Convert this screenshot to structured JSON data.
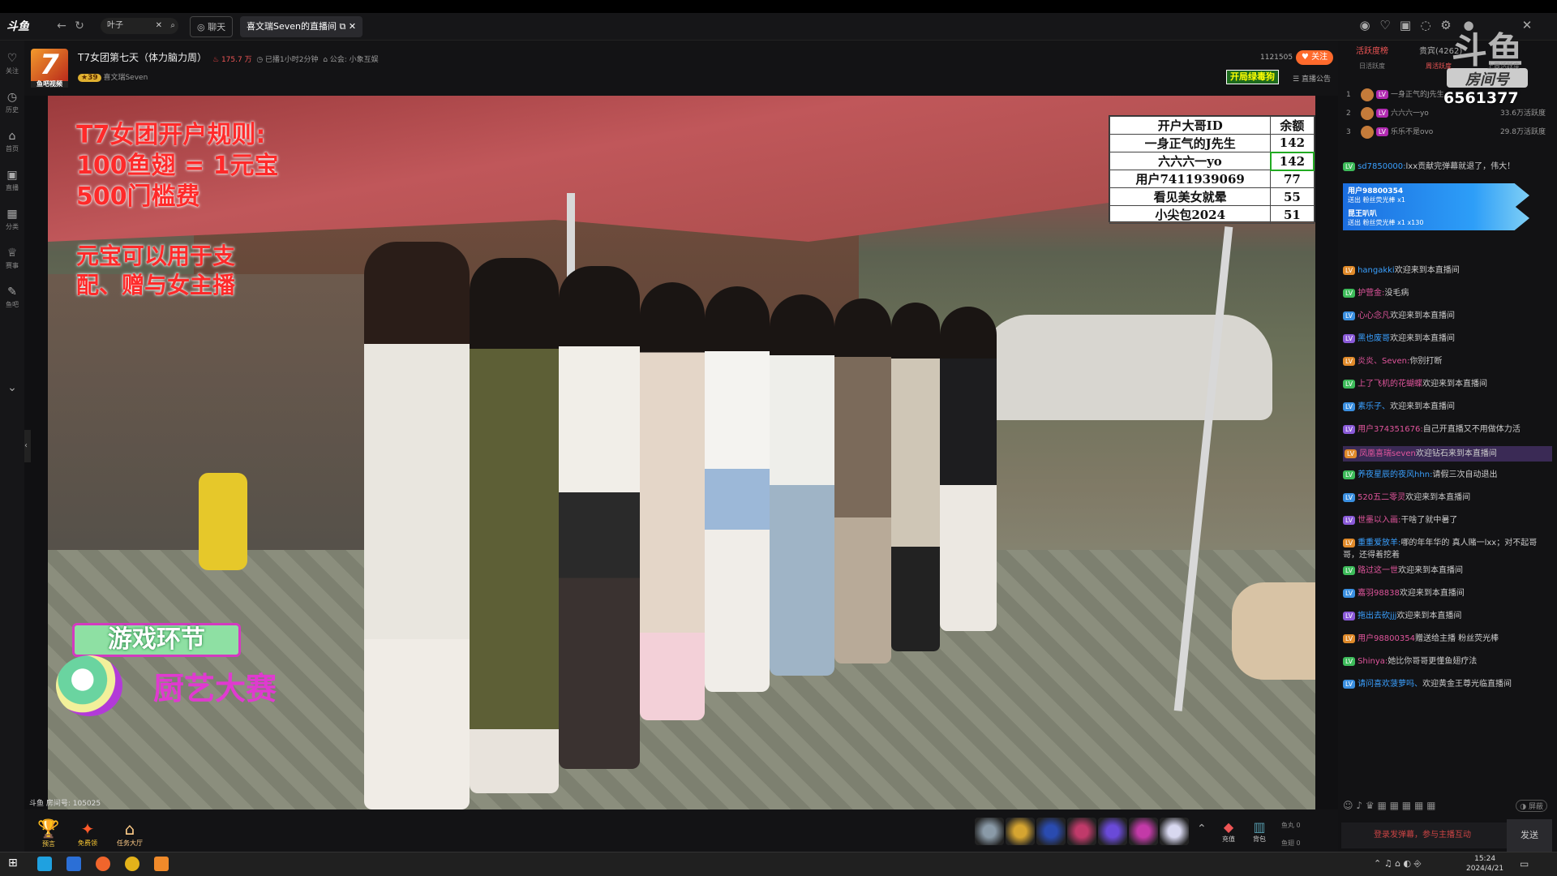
{
  "browser": {
    "logo": "斗鱼",
    "search_value": "叶子",
    "tabs": [
      "聊天",
      "喜文瑞Seven的直播间"
    ]
  },
  "leftrail": [
    {
      "icon": "heart-icon",
      "label": "关注"
    },
    {
      "icon": "clock-icon",
      "label": "历史"
    },
    {
      "icon": "home-icon",
      "label": "首页"
    },
    {
      "icon": "tv-icon",
      "label": "直播"
    },
    {
      "icon": "grid-icon",
      "label": "分类"
    },
    {
      "icon": "trophy-icon",
      "label": "赛事"
    },
    {
      "icon": "bar-icon",
      "label": "鱼吧"
    }
  ],
  "room": {
    "avatar_text": "7",
    "avatar_sub": "鱼吧视频",
    "title": "T7女团第七天（体力脑力周）",
    "hot": "175.7 万",
    "duration": "已播1小时2分钟",
    "notice": "公会: 小象互娱",
    "anchor": "喜文瑞Seven",
    "count": "1121505",
    "follow_label": "关注",
    "tag": "开局绿毒狗",
    "announce_label": "直播公告"
  },
  "video": {
    "rules_title": [
      "T7女团开户规则:",
      "100鱼翅 = 1元宝",
      "500门槛费"
    ],
    "rules_body": [
      "元宝可以用于支",
      "配、赠与女主播"
    ],
    "board_headers": [
      "开户大哥ID",
      "余额"
    ],
    "board_rows": [
      [
        "一身正气的J先生",
        "142"
      ],
      [
        "六六六一yo",
        "142"
      ],
      [
        "用户7411939069",
        "77"
      ],
      [
        "看见美女就晕",
        "55"
      ],
      [
        "小尖包2024",
        "51"
      ]
    ],
    "game_label": "游戏环节",
    "game_title": "厨艺大赛",
    "watermark": "斗鱼 房间号: 105025"
  },
  "bottom": {
    "left_items": [
      "预言",
      "免费领",
      "任务大厅"
    ],
    "right_items": [
      "充值",
      "背包"
    ],
    "fish_ball": "鱼丸 0",
    "fish_fin": "鱼翅 0"
  },
  "right": {
    "tabs": [
      "活跃度榜",
      "贵宾(4262)"
    ],
    "subtabs": [
      "日活跃度",
      "周活跃度",
      "上周活跃度"
    ],
    "room_label": "房间号",
    "room_id": "6561377",
    "douyu_mark": "斗鱼",
    "ranks": [
      {
        "n": "1",
        "name": "一身正气的J先生",
        "v": ""
      },
      {
        "n": "2",
        "name": "六六六一yo",
        "v": "33.6万活跃度"
      },
      {
        "n": "3",
        "name": "乐乐不是ovo",
        "v": "29.8万活跃度"
      }
    ],
    "chat": [
      {
        "lv": "LV",
        "name": "sd7850000:",
        "text": "lxx贡献完弹幕就退了，伟大！"
      },
      {
        "lv": "",
        "name": "用户98800354",
        "text": "送出 粉丝荧光棒 x1",
        "banner": true
      },
      {
        "lv": "",
        "name": "昆王叭叭",
        "text": "送出 粉丝荧光棒 x1 x130",
        "banner": true
      },
      {
        "lv": "LV",
        "name": "hangakki",
        "text": "欢迎来到本直播间"
      },
      {
        "lv": "LV",
        "name": "护营金:",
        "text": "没毛病"
      },
      {
        "lv": "LV",
        "name": "心心念凡",
        "text": "欢迎来到本直播间"
      },
      {
        "lv": "LV",
        "name": "黑也废哥",
        "text": "欢迎来到本直播间"
      },
      {
        "lv": "LV",
        "name": "炎炎、Seven:",
        "text": "你别打断"
      },
      {
        "lv": "LV",
        "name": "上了飞机的花蝴蝶",
        "text": "欢迎来到本直播间"
      },
      {
        "lv": "LV",
        "name": "素乐子、",
        "text": "欢迎来到本直播间"
      },
      {
        "lv": "LV",
        "name": "用户374351676:",
        "text": "自己开直播又不用做体力活"
      },
      {
        "lv": "LV",
        "name": "凤凰喜瑞seven",
        "text": "欢迎钻石来到本直播间"
      },
      {
        "lv": "LV",
        "name": "养夜星辰的夜风hhn:",
        "text": "请假三次自动退出"
      },
      {
        "lv": "LV",
        "name": "520五二零灵",
        "text": "欢迎来到本直播间"
      },
      {
        "lv": "LV",
        "name": "世墨以入画:",
        "text": "干啥了就中暑了"
      },
      {
        "lv": "LV",
        "name": "重重爱放羊:",
        "text": "哪的年年华的 真人赌一lxx；对不起哥哥，还得着挖着"
      },
      {
        "lv": "LV",
        "name": "路过这一世",
        "text": "欢迎来到本直播间"
      },
      {
        "lv": "LV",
        "name": "嘉羽98838",
        "text": "欢迎来到本直播间"
      },
      {
        "lv": "LV",
        "name": "拖出去砍jjj",
        "text": "欢迎来到本直播间"
      },
      {
        "lv": "LV",
        "name": "用户98800354",
        "text": "赠送给主播 粉丝荧光棒"
      },
      {
        "lv": "LV",
        "name": "Shinya:",
        "text": "她比你哥哥更懂鱼翅疗法"
      },
      {
        "lv": "LV",
        "name": "请问喜欢菠萝吗、",
        "text": "欢迎黄金王尊光临直播间"
      }
    ],
    "input_placeholder": "登录发弹幕，参与主播互动",
    "send_label": "发送"
  },
  "taskbar": {
    "time": "15:24",
    "date": "2024/4/21"
  }
}
